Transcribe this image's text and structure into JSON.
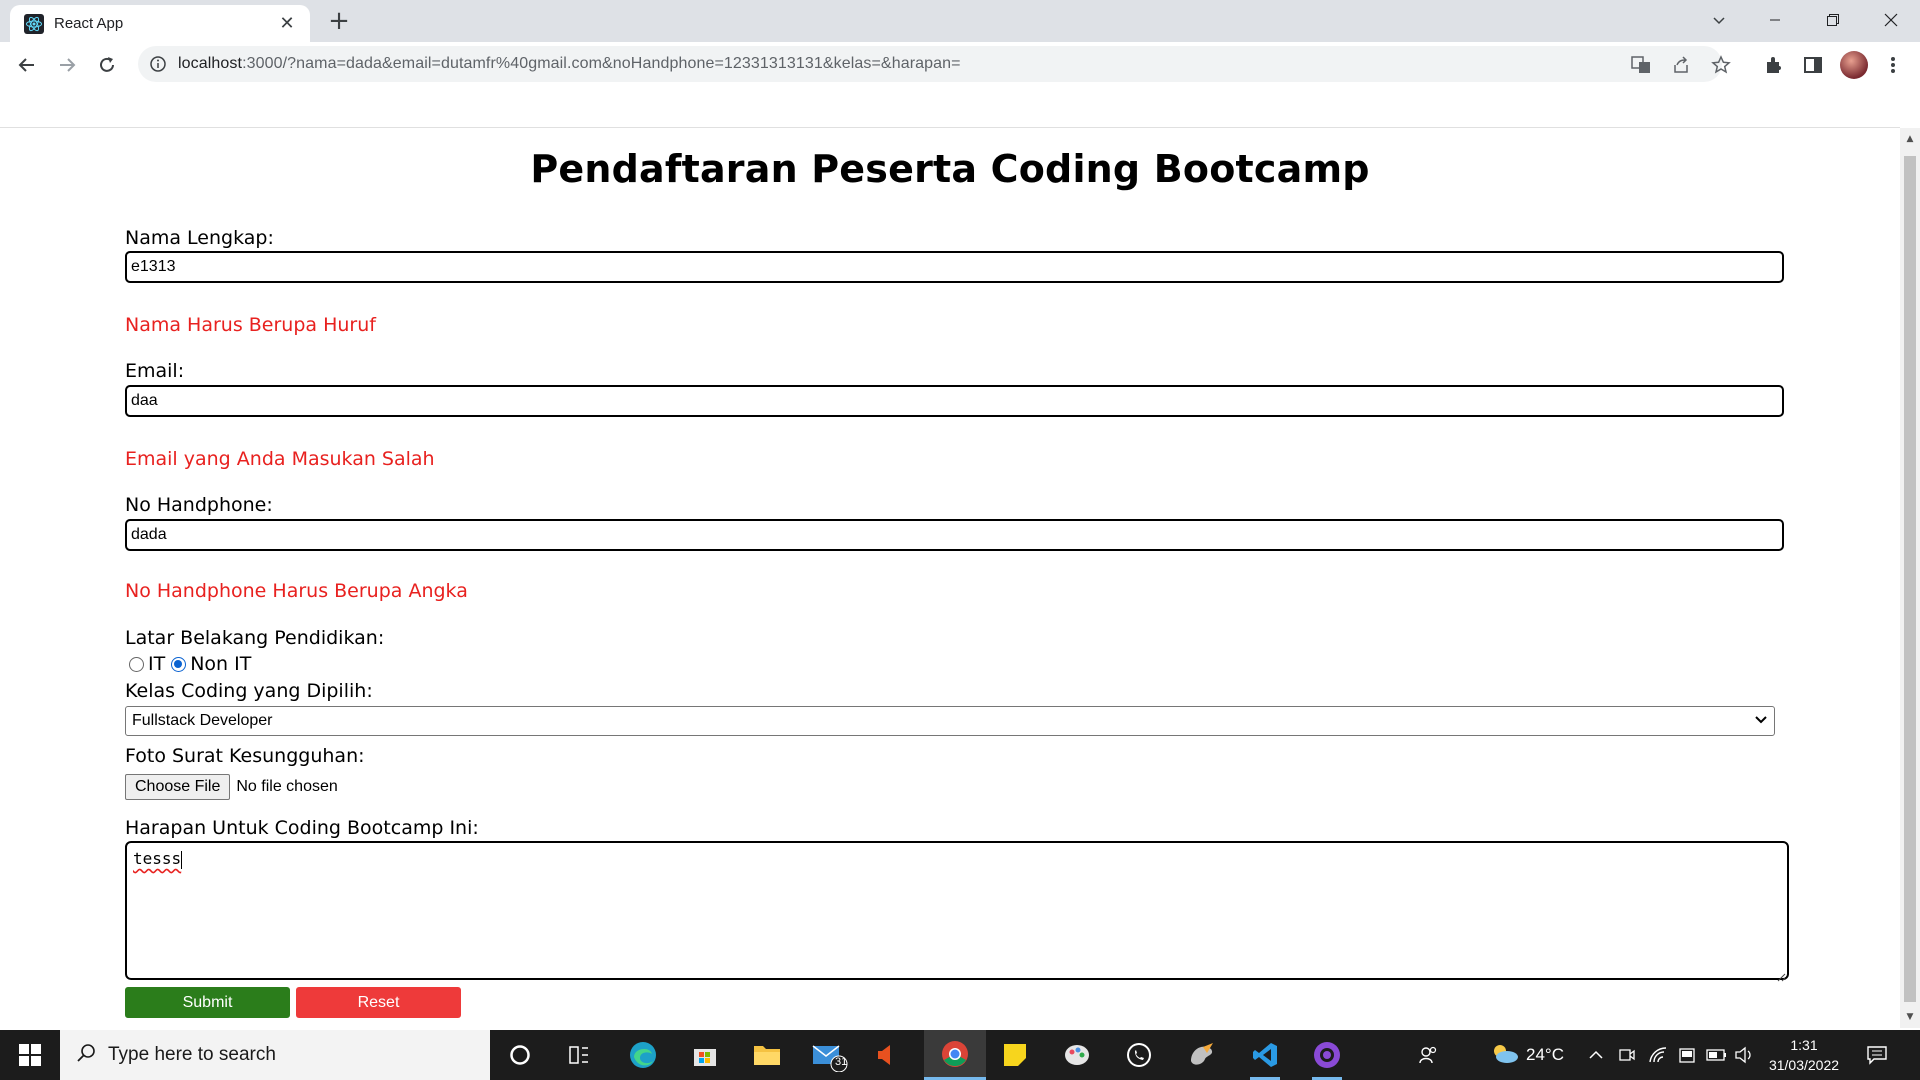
{
  "browser": {
    "tab_title": "React App",
    "url_host": "localhost",
    "url_rest": ":3000/?nama=dada&email=dutamfr%40gmail.com&noHandphone=12331313131&kelas=&harapan="
  },
  "form": {
    "title": "Pendaftaran Peserta Coding Bootcamp",
    "nama_label": "Nama Lengkap:",
    "nama_value": "e1313",
    "nama_error": "Nama Harus Berupa Huruf",
    "email_label": "Email:",
    "email_value": "daa",
    "email_error": "Email yang Anda Masukan Salah",
    "hp_label": "No Handphone:",
    "hp_value": "dada",
    "hp_error": "No Handphone Harus Berupa Angka",
    "latar_label": "Latar Belakang Pendidikan:",
    "radio_options": [
      "IT",
      "Non IT"
    ],
    "radio_selected": "Non IT",
    "kelas_label": "Kelas Coding yang Dipilih:",
    "kelas_selected": "Fullstack Developer",
    "foto_label": "Foto Surat Kesungguhan:",
    "file_button": "Choose File",
    "file_status": "No file chosen",
    "harapan_label": "Harapan Untuk Coding Bootcamp Ini:",
    "harapan_value": "tesss",
    "submit_label": "Submit",
    "reset_label": "Reset"
  },
  "taskbar": {
    "search_placeholder": "Type here to search",
    "mail_badge": "31",
    "temperature": "24°C",
    "time": "1:31",
    "date": "31/03/2022"
  }
}
